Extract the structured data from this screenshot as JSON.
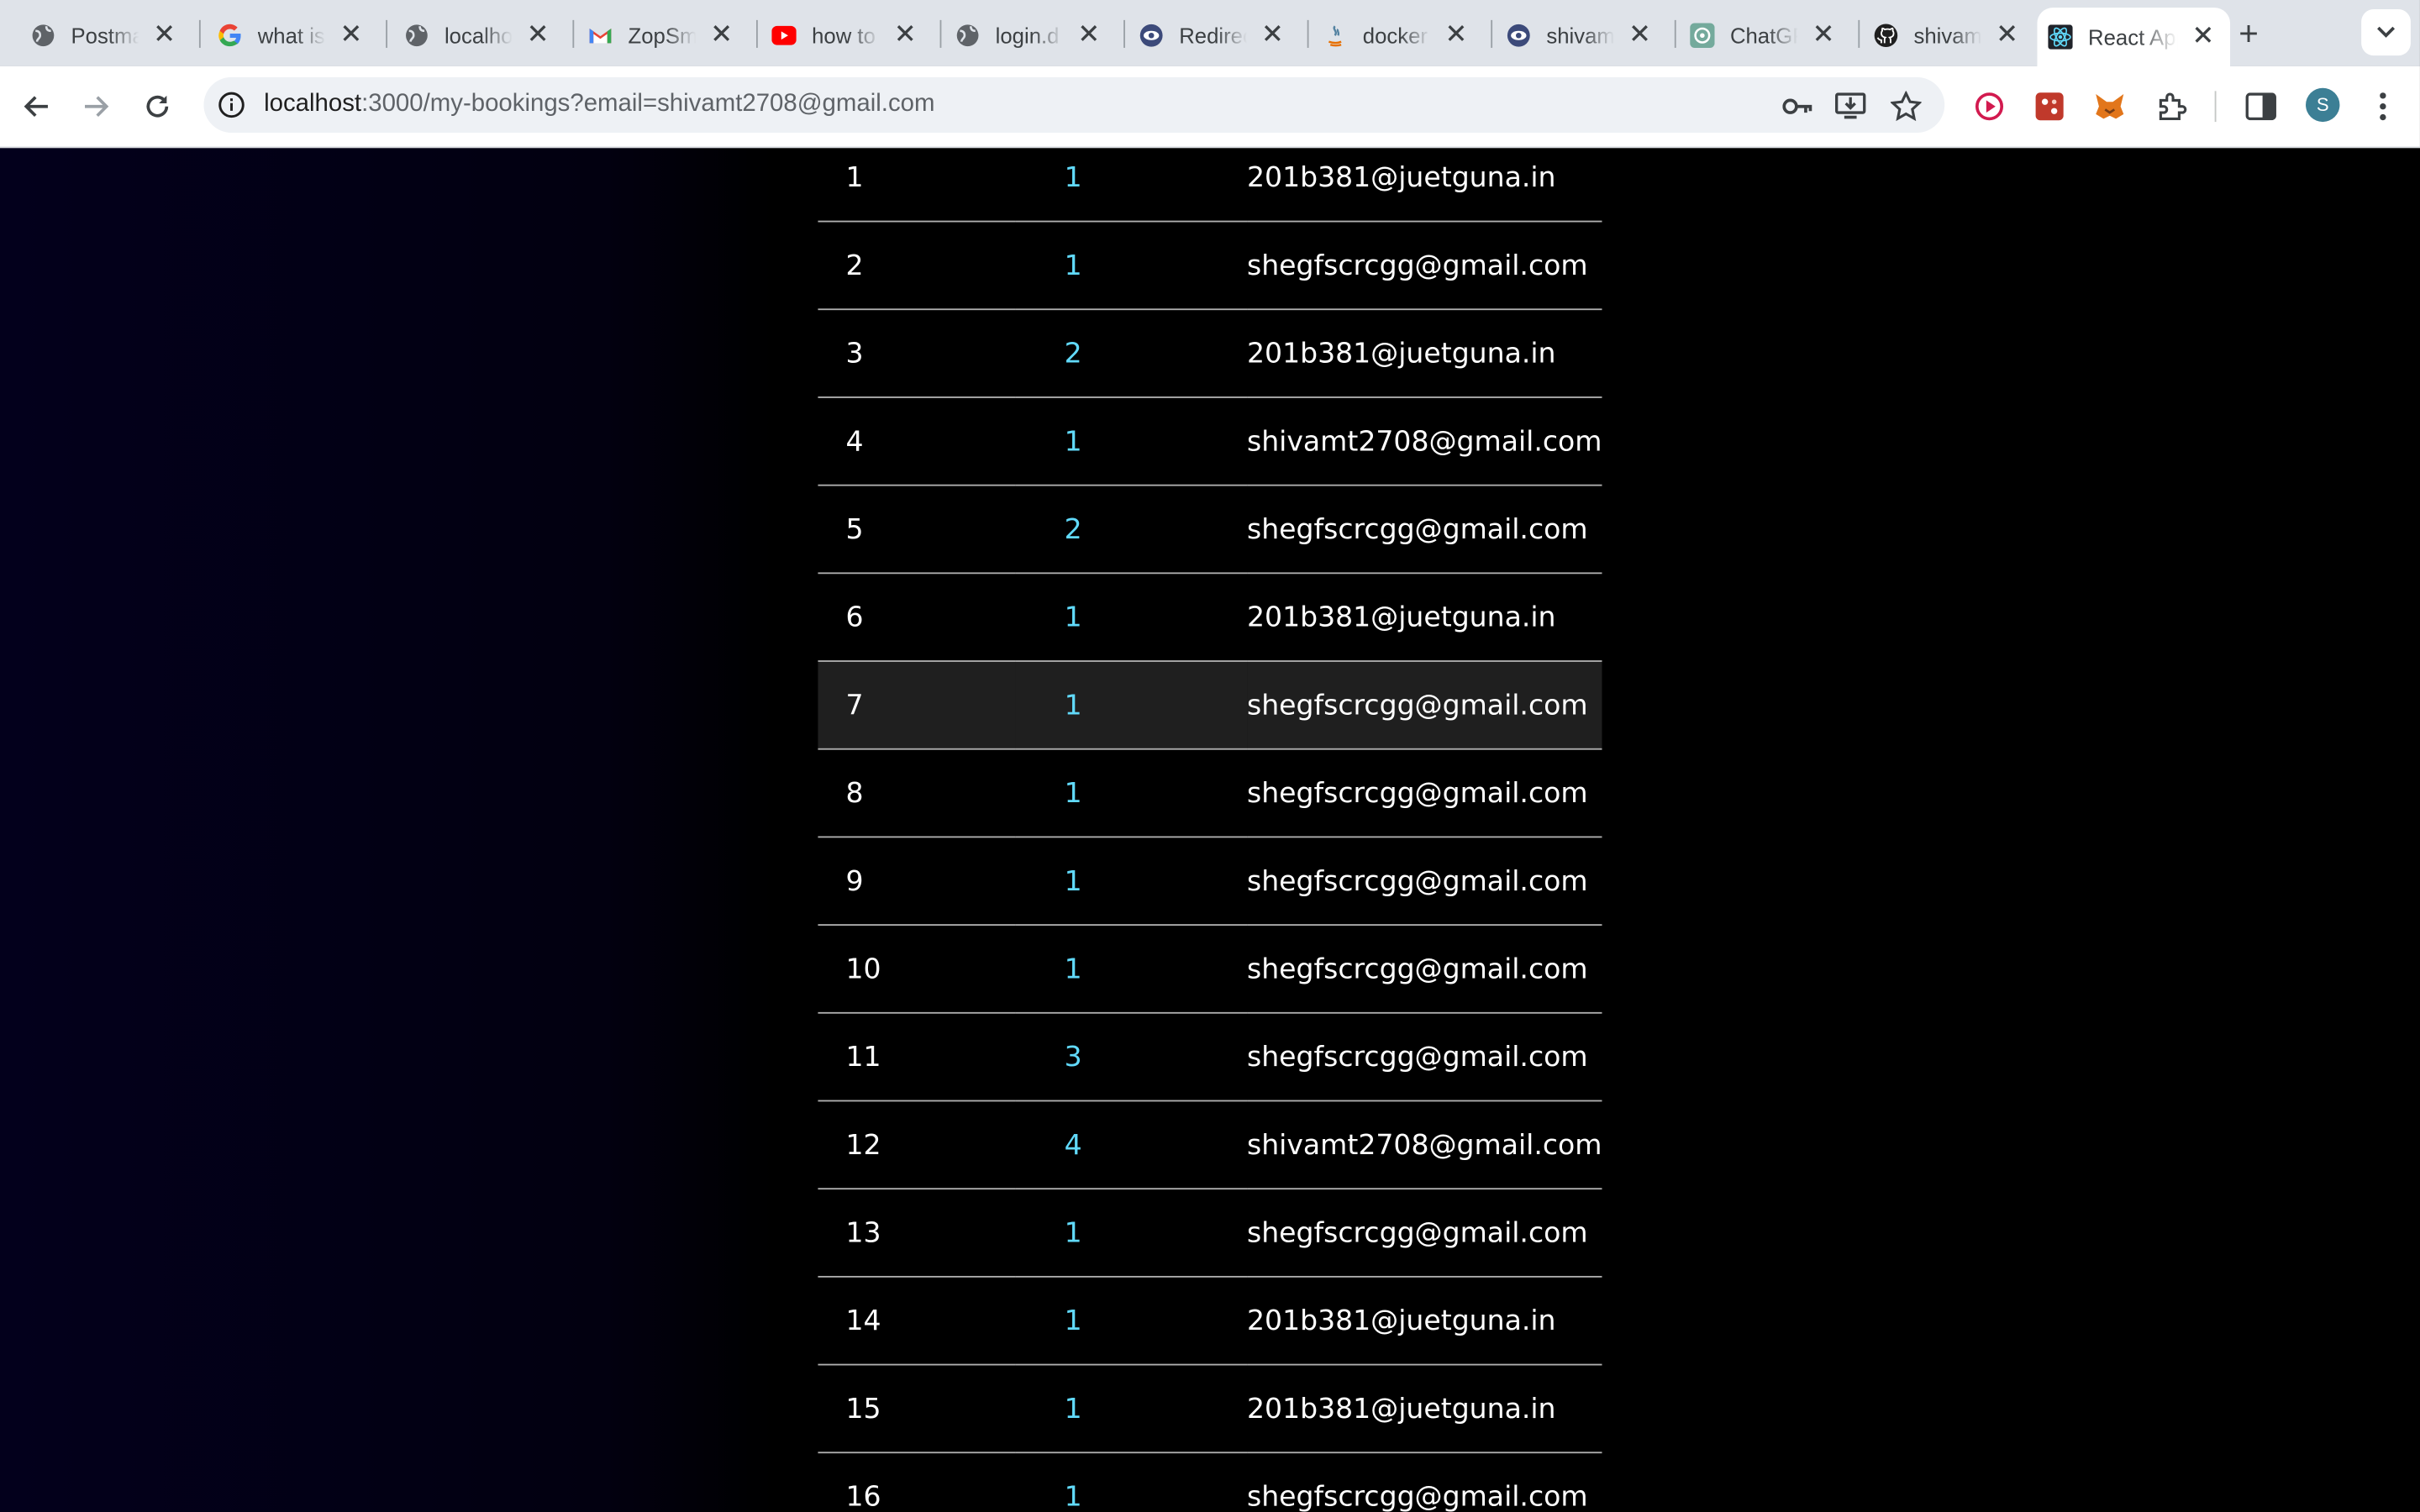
{
  "browser": {
    "tabs": [
      {
        "title": "Postman",
        "icon": "globe-icon"
      },
      {
        "title": "what is",
        "icon": "google-icon"
      },
      {
        "title": "localhost",
        "icon": "globe-icon"
      },
      {
        "title": "ZopSmart",
        "icon": "gmail-icon"
      },
      {
        "title": "how to",
        "icon": "youtube-icon"
      },
      {
        "title": "login.d",
        "icon": "globe-icon"
      },
      {
        "title": "Redirect",
        "icon": "eye-icon"
      },
      {
        "title": "docker",
        "icon": "java-icon"
      },
      {
        "title": "shivam",
        "icon": "eye-icon"
      },
      {
        "title": "ChatGPT",
        "icon": "chatgpt-icon"
      },
      {
        "title": "shivam",
        "icon": "github-icon"
      },
      {
        "title": "React App",
        "icon": "react-icon",
        "active": true
      }
    ],
    "new_tab_label": "+",
    "address": {
      "host": "localhost",
      "rest": ":3000/my-bookings?email=shivamt2708@gmail.com"
    },
    "profile_initial": "S"
  },
  "colors": {
    "quantity": "#61dafb",
    "page_left": "#03001c",
    "page_right": "#000000",
    "highlight_row": "#1f1f1f"
  },
  "bookings": {
    "rows": [
      {
        "id": "1",
        "qty": "1",
        "email": "201b381@juetguna.in"
      },
      {
        "id": "2",
        "qty": "1",
        "email": "shegfscrcgg@gmail.com"
      },
      {
        "id": "3",
        "qty": "2",
        "email": "201b381@juetguna.in"
      },
      {
        "id": "4",
        "qty": "1",
        "email": "shivamt2708@gmail.com"
      },
      {
        "id": "5",
        "qty": "2",
        "email": "shegfscrcgg@gmail.com"
      },
      {
        "id": "6",
        "qty": "1",
        "email": "201b381@juetguna.in"
      },
      {
        "id": "7",
        "qty": "1",
        "email": "shegfscrcgg@gmail.com",
        "highlighted": true
      },
      {
        "id": "8",
        "qty": "1",
        "email": "shegfscrcgg@gmail.com"
      },
      {
        "id": "9",
        "qty": "1",
        "email": "shegfscrcgg@gmail.com"
      },
      {
        "id": "10",
        "qty": "1",
        "email": "shegfscrcgg@gmail.com"
      },
      {
        "id": "11",
        "qty": "3",
        "email": "shegfscrcgg@gmail.com"
      },
      {
        "id": "12",
        "qty": "4",
        "email": "shivamt2708@gmail.com"
      },
      {
        "id": "13",
        "qty": "1",
        "email": "shegfscrcgg@gmail.com"
      },
      {
        "id": "14",
        "qty": "1",
        "email": "201b381@juetguna.in"
      },
      {
        "id": "15",
        "qty": "1",
        "email": "201b381@juetguna.in"
      },
      {
        "id": "16",
        "qty": "1",
        "email": "shegfscrcgg@gmail.com"
      }
    ]
  }
}
